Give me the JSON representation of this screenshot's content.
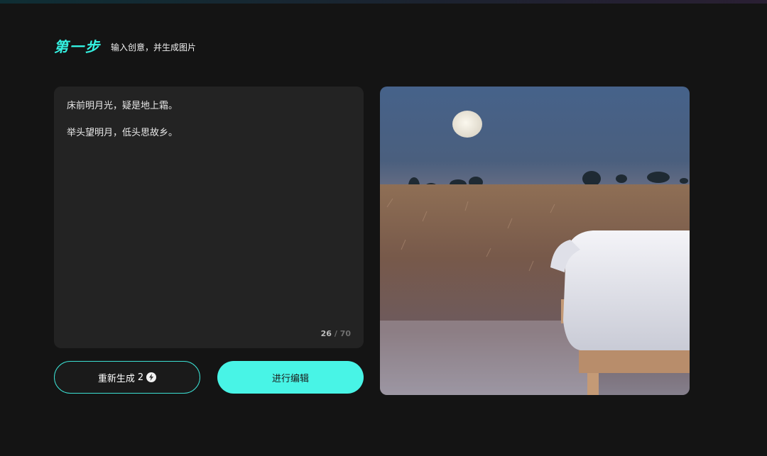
{
  "header": {
    "step_title": "第一步",
    "step_subtitle": "输入创意，并生成图片"
  },
  "editor": {
    "text": "床前明月光，疑是地上霜。\n\n举头望明月，低头思故乡。",
    "count": "26",
    "separator": "/",
    "max": "70"
  },
  "actions": {
    "regenerate_label": "重新生成",
    "regenerate_cost": "2",
    "edit_label": "进行编辑"
  },
  "image": {
    "icon": "lightning-icon",
    "colors": {
      "accent": "#48f4e6",
      "sky": "#3f5b7e",
      "moon": "#f3efe4"
    }
  }
}
